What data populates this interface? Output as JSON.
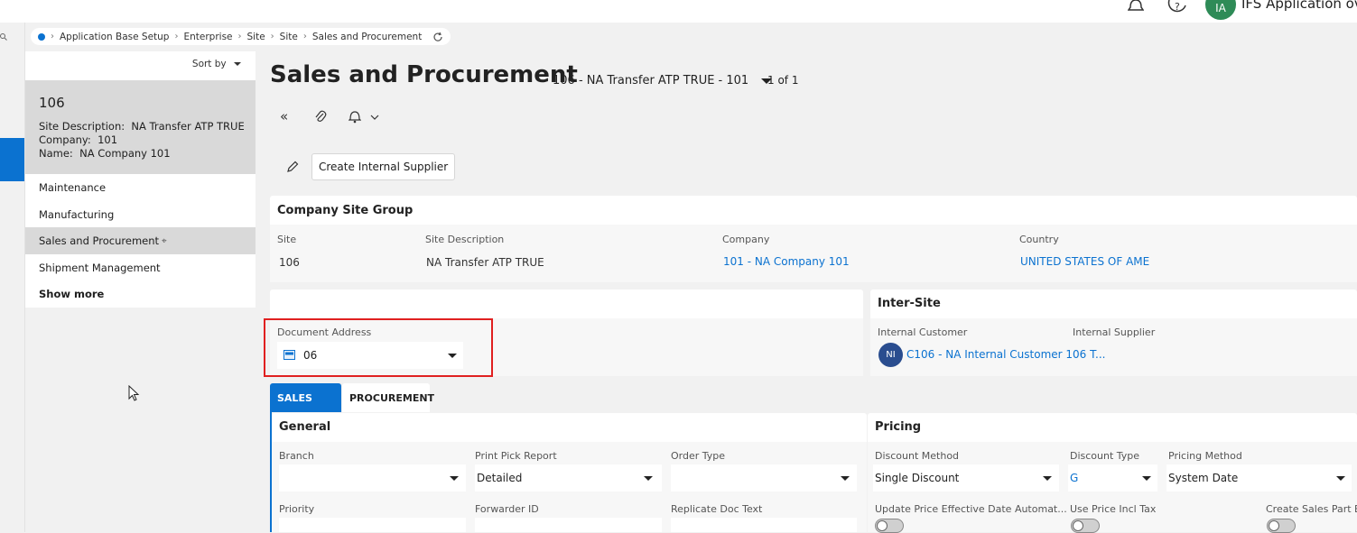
{
  "header": {
    "user_initials": "IA",
    "user_name": "IFS Application ov"
  },
  "breadcrumb": [
    "Application Base Setup",
    "Enterprise",
    "Site",
    "Site",
    "Sales and Procurement"
  ],
  "nav": {
    "sort_label": "Sort by",
    "record": {
      "id": "106",
      "site_description_label": "Site Description:",
      "site_description": "NA Transfer ATP TRUE",
      "company_label": "Company:",
      "company": "101",
      "name_label": "Name:",
      "name": "NA Company 101"
    },
    "items": [
      "Maintenance",
      "Manufacturing",
      "Sales and Procurement",
      "Shipment Management"
    ],
    "show_more": "Show more"
  },
  "page": {
    "title": "Sales and Procurement",
    "record_selector": "106 - NA Transfer ATP TRUE - 101",
    "counter": "1 of 1",
    "create_internal_supplier": "Create Internal Supplier"
  },
  "company_site_group": {
    "title": "Company Site Group",
    "site_label": "Site",
    "site": "106",
    "site_description_label": "Site Description",
    "site_description": "NA Transfer ATP TRUE",
    "company_label": "Company",
    "company": "101 - NA Company 101",
    "country_label": "Country",
    "country": "UNITED STATES OF AME"
  },
  "document_address": {
    "label": "Document Address",
    "value": "06"
  },
  "inter_site": {
    "title": "Inter-Site",
    "internal_customer_label": "Internal Customer",
    "internal_supplier_label": "Internal Supplier",
    "customer_initials": "NI",
    "internal_customer": "C106 - NA Internal Customer 106 T..."
  },
  "tabs": [
    "SALES",
    "PROCUREMENT"
  ],
  "general": {
    "title": "General",
    "branch_label": "Branch",
    "branch": "",
    "print_pick_report_label": "Print Pick Report",
    "print_pick_report": "Detailed",
    "order_type_label": "Order Type",
    "order_type": "",
    "priority_label": "Priority",
    "forwarder_id_label": "Forwarder ID",
    "replicate_doc_text_label": "Replicate Doc Text"
  },
  "pricing": {
    "title": "Pricing",
    "discount_method_label": "Discount Method",
    "discount_method": "Single Discount",
    "discount_type_label": "Discount Type",
    "discount_type": "G",
    "pricing_method_label": "Pricing Method",
    "pricing_method": "System Date",
    "update_price_label": "Update Price Effective Date Automat...",
    "use_price_incl_tax_label": "Use Price Incl Tax",
    "create_sales_part_label": "Create Sales Part Ba"
  },
  "colors": {
    "accent": "#0b72d0",
    "highlight_border": "#e02020",
    "avatar_user": "#2e8b57",
    "avatar_customer": "#2a4d8f"
  }
}
